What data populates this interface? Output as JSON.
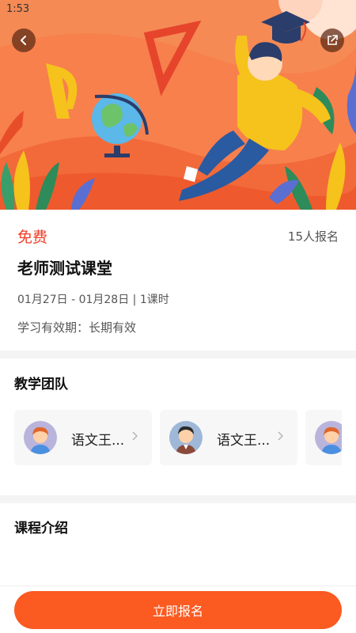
{
  "status_bar": {
    "time": "1:53"
  },
  "header": {
    "back_icon": "chevron-left-icon",
    "share_icon": "share-icon",
    "banner_colors": {
      "background": "#f7804d",
      "accent_yellow": "#f6c21c",
      "globe_blue": "#5bb8e8"
    }
  },
  "course": {
    "price": "免费",
    "enroll_count": "15人报名",
    "title": "老师测试课堂",
    "date_line": "01月27日 - 01月28日  |  1课时",
    "validity": "学习有效期：长期有效"
  },
  "team": {
    "title": "教学团队",
    "teachers": [
      {
        "name": "语文王..."
      },
      {
        "name": "语文王..."
      },
      {
        "name": ""
      }
    ]
  },
  "intro": {
    "title": "课程介绍"
  },
  "footer": {
    "signup_label": "立即报名",
    "accent": "#fb5a20"
  }
}
